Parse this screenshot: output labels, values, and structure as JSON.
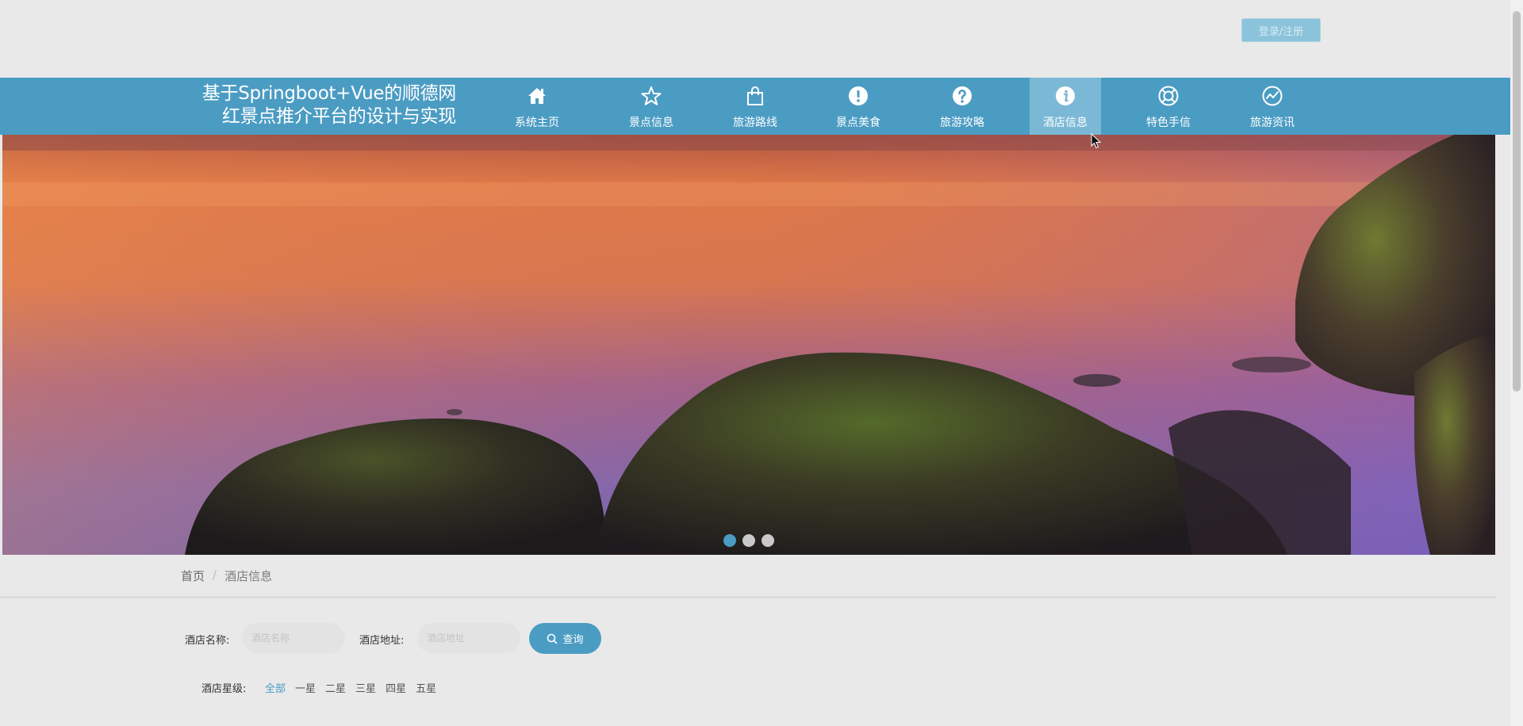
{
  "header": {
    "login_label": "登录/注册"
  },
  "nav": {
    "title_line1": "基于Springboot+Vue的顺德网",
    "title_line2": "红景点推介平台的设计与实现",
    "items": [
      {
        "label": "系统主页",
        "icon": "home-icon"
      },
      {
        "label": "景点信息",
        "icon": "star-icon"
      },
      {
        "label": "旅游路线",
        "icon": "shopping-bag-icon"
      },
      {
        "label": "景点美食",
        "icon": "exclamation-circle-icon"
      },
      {
        "label": "旅游攻略",
        "icon": "question-circle-icon"
      },
      {
        "label": "酒店信息",
        "icon": "info-circle-icon",
        "active": true
      },
      {
        "label": "特色手信",
        "icon": "lifebuoy-icon"
      },
      {
        "label": "旅游资讯",
        "icon": "chart-circle-icon"
      }
    ],
    "accent_color": "#4b9cc3"
  },
  "carousel": {
    "slide_count": 3,
    "active_index": 0
  },
  "breadcrumb": {
    "home": "首页",
    "separator": "/",
    "current": "酒店信息"
  },
  "search": {
    "name_label": "酒店名称:",
    "name_placeholder": "酒店名称",
    "address_label": "酒店地址:",
    "address_placeholder": "酒店地址",
    "button_label": "查询"
  },
  "star_filter": {
    "label": "酒店星级:",
    "options": [
      "全部",
      "一星",
      "二星",
      "三星",
      "四星",
      "五星"
    ],
    "active": "全部"
  }
}
